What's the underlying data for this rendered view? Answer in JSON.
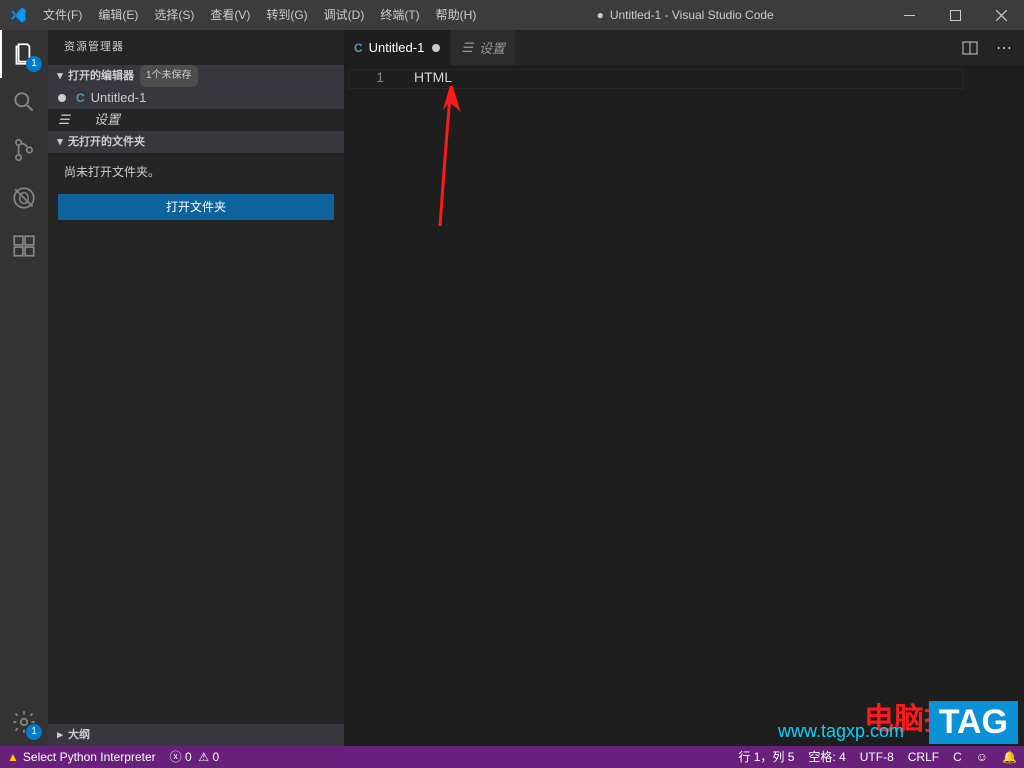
{
  "window": {
    "title": "Untitled-1 - Visual Studio Code",
    "dot": "●"
  },
  "menu": [
    "文件(F)",
    "编辑(E)",
    "选择(S)",
    "查看(V)",
    "转到(G)",
    "调试(D)",
    "终端(T)",
    "帮助(H)"
  ],
  "activity": {
    "explorer_badge": "1",
    "gear_badge": "1"
  },
  "sidebar": {
    "title": "资源管理器",
    "open_editors": {
      "label": "打开的编辑器",
      "unsaved_tag": "1个未保存",
      "items": [
        {
          "lang": "C",
          "name": "Untitled-1",
          "dirty": true
        },
        {
          "gear": true,
          "name": "设置"
        }
      ]
    },
    "no_folder_section": "无打开的文件夹",
    "no_folder_msg": "尚未打开文件夹。",
    "open_folder_btn": "打开文件夹",
    "outline": "大纲"
  },
  "tabs": [
    {
      "lang": "C",
      "name": "Untitled-1",
      "dirty": true,
      "active": true
    },
    {
      "gear": true,
      "name": "设置",
      "italic": true
    }
  ],
  "editor": {
    "line_number": "1",
    "code": "HTML"
  },
  "status": {
    "python_warn": "Select Python Interpreter",
    "errors": "0",
    "warnings": "0",
    "ln_col": "行 1，列 5",
    "spaces": "空格: 4",
    "encoding": "UTF-8",
    "eol": "CRLF",
    "lang": "C",
    "feedback": "☺",
    "bell": "🔔"
  },
  "watermark": {
    "l1": "电脑技术网",
    "l2": "www.tagxp.com",
    "tag": "TAG"
  }
}
